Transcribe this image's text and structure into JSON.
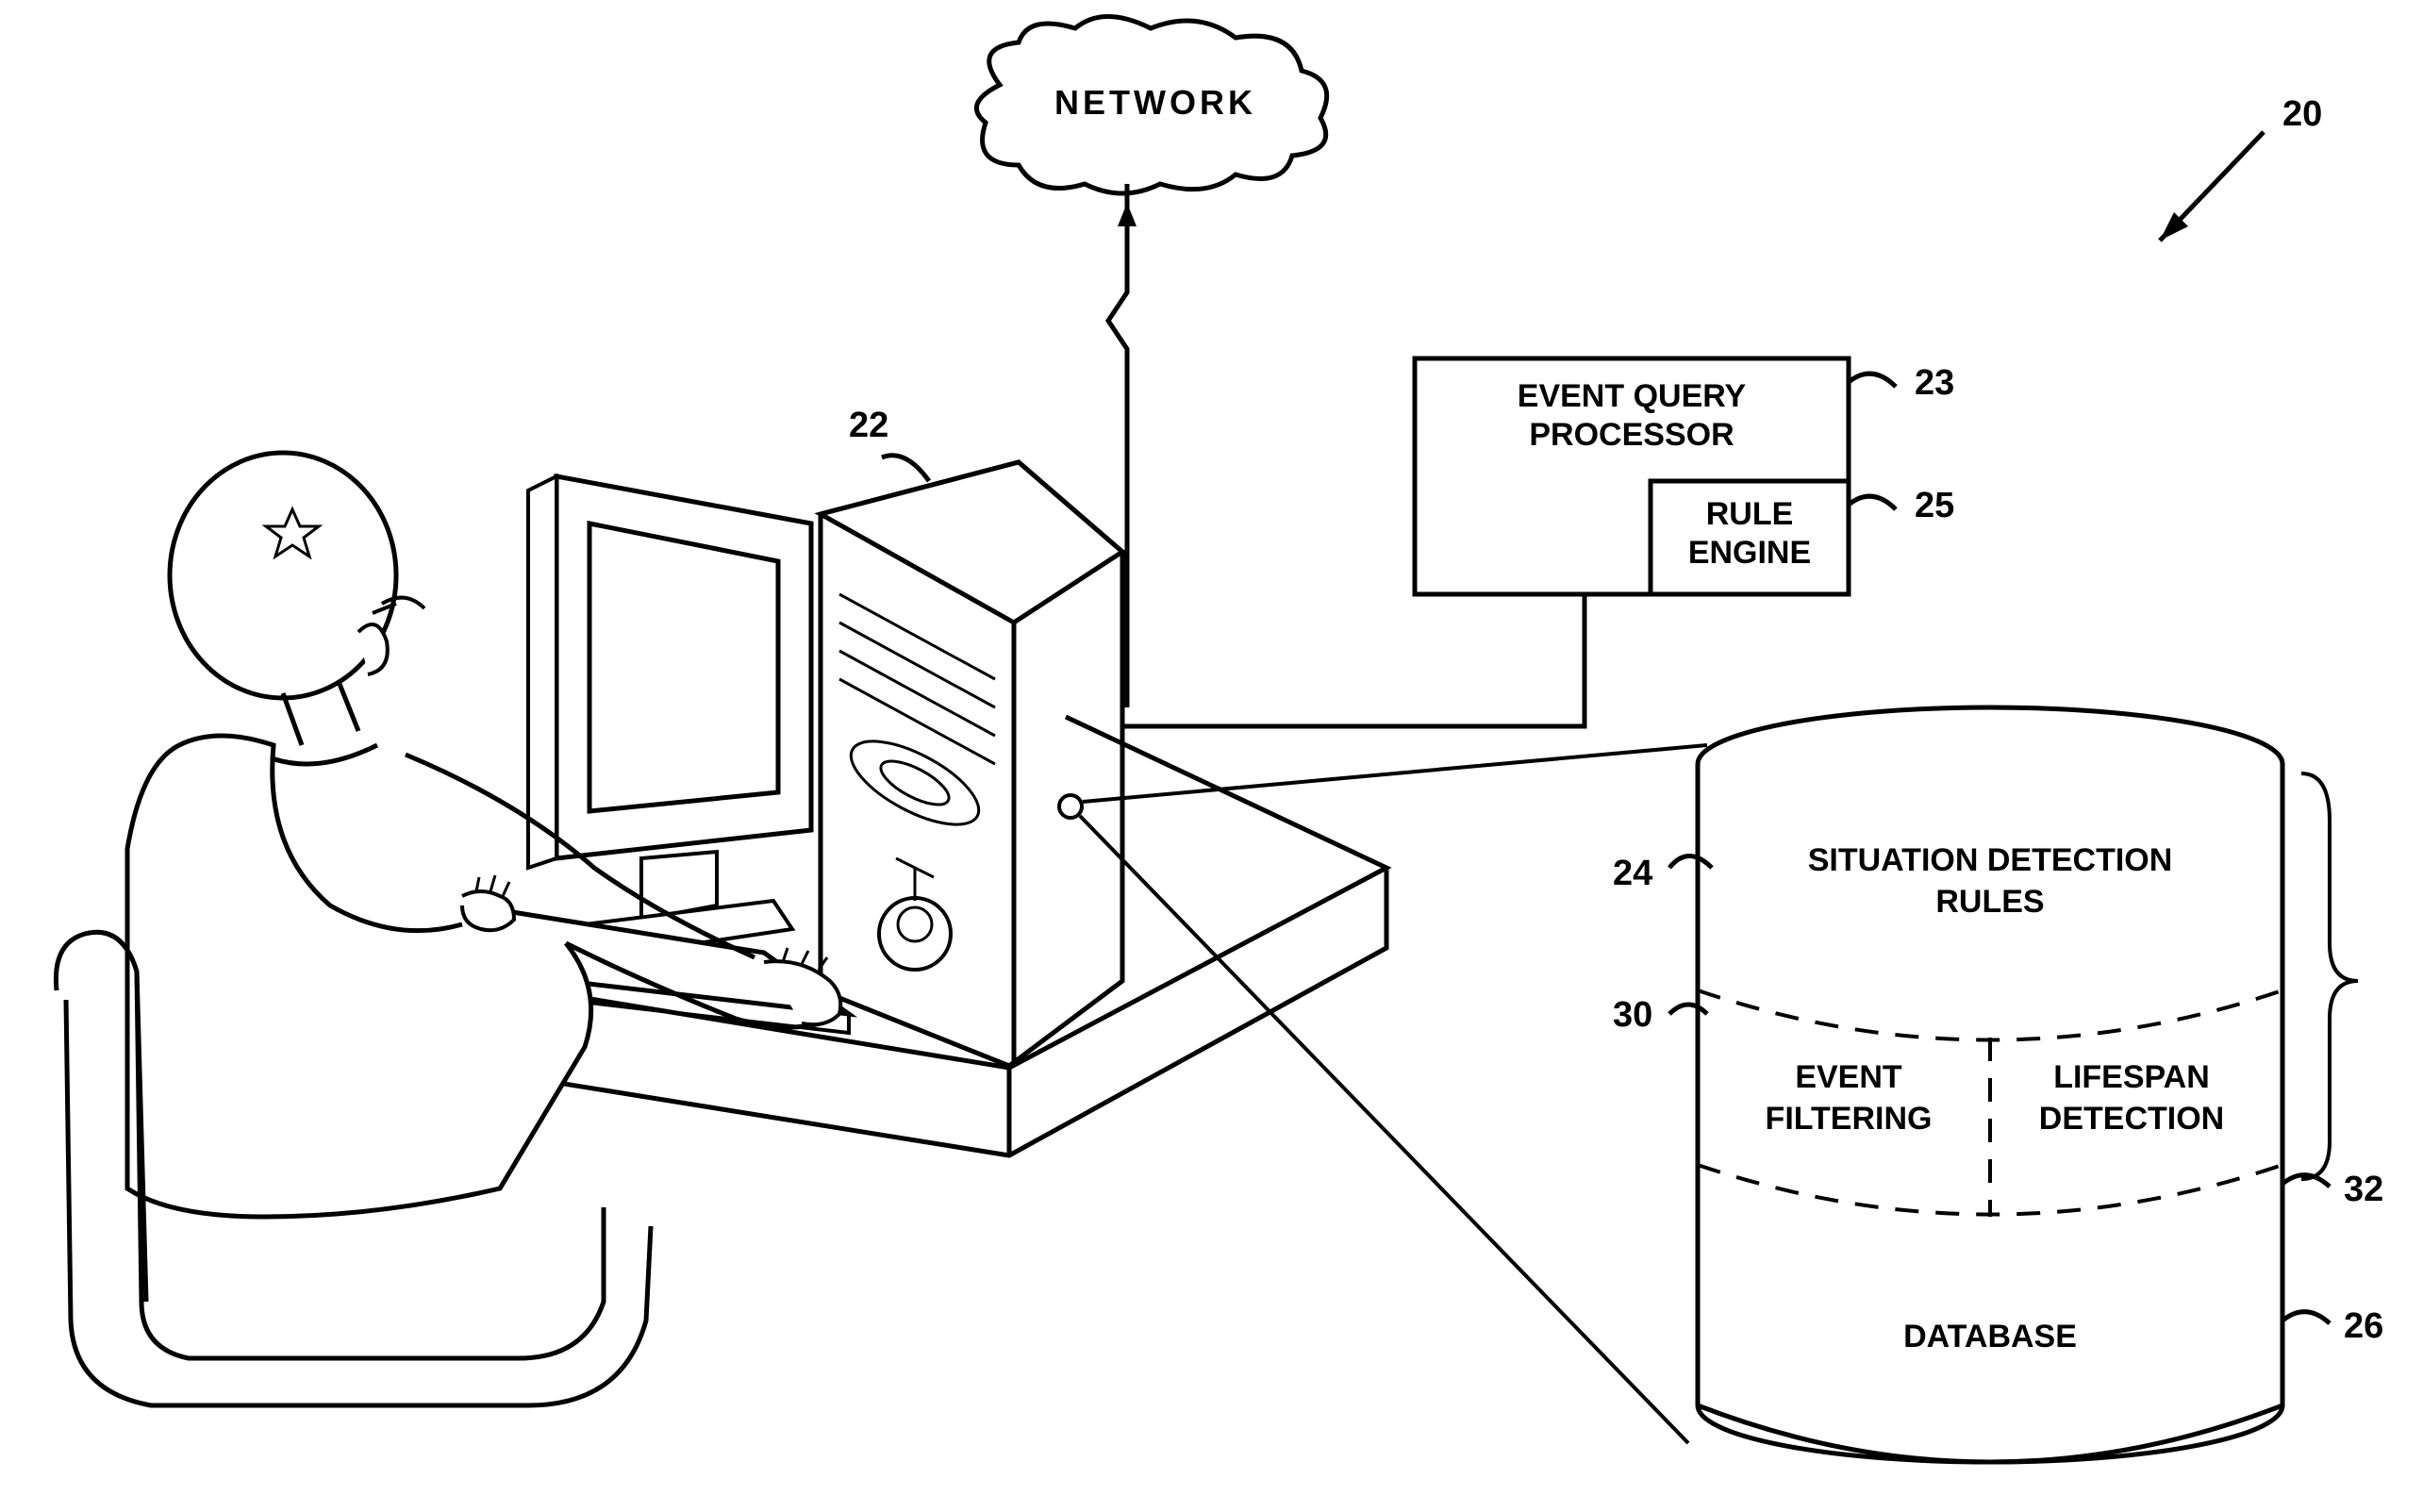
{
  "network": {
    "label": "NETWORK"
  },
  "references": {
    "system": "20",
    "computer": "22",
    "event_query_processor": "23",
    "situation_detection": "24",
    "rule_engine": "25",
    "database": "26",
    "event_filtering": "30",
    "lifespan_detection": "32"
  },
  "boxes": {
    "event_query_processor": "EVENT QUERY PROCESSOR",
    "rule_engine": "RULE ENGINE"
  },
  "cylinder": {
    "situation_detection_rules": "SITUATION DETECTION RULES",
    "event_filtering": "EVENT FILTERING",
    "lifespan_detection": "LIFESPAN DETECTION",
    "database": "DATABASE"
  }
}
